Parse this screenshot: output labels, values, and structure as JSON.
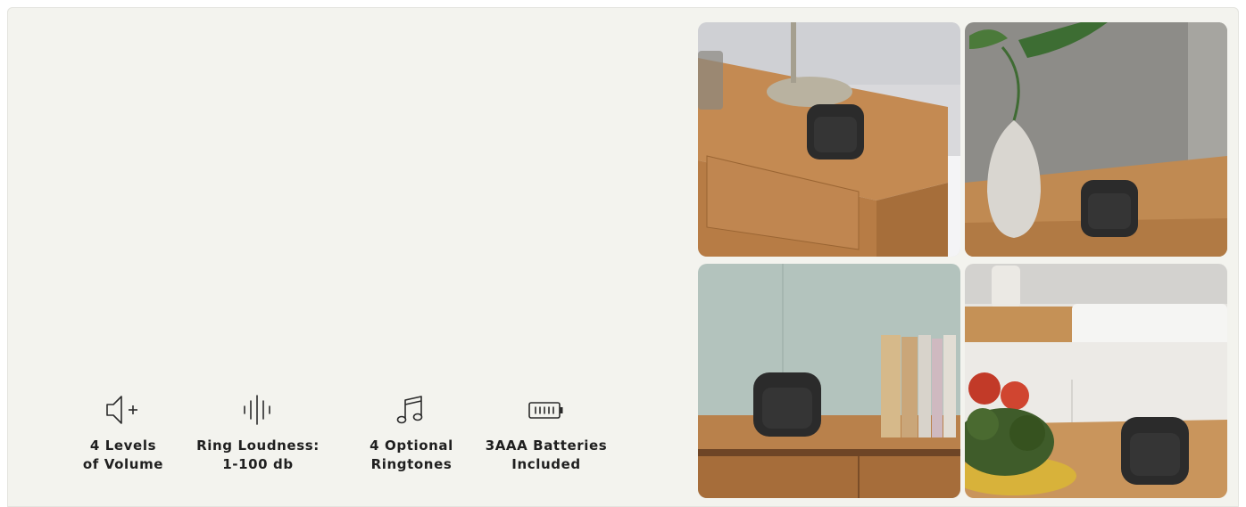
{
  "features": [
    {
      "icon": "speaker-volume-plus-icon",
      "label": "4 Levels\nof Volume"
    },
    {
      "icon": "sound-wave-icon",
      "label": "Ring Loudness:\n1-100 db"
    },
    {
      "icon": "music-note-icon",
      "label": "4 Optional\nRingtones"
    },
    {
      "icon": "battery-icon",
      "label": "3AAA Batteries\nIncluded"
    }
  ],
  "colors": {
    "panel_background": "#f3f3ee",
    "text": "#1f1f1f",
    "wood": "#c8925a",
    "device": "#2b2b2b"
  }
}
